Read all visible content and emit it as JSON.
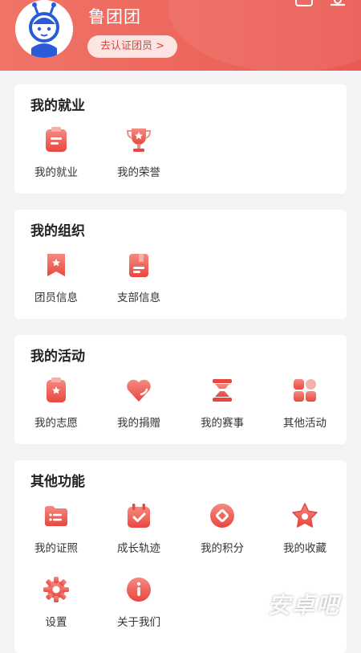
{
  "header": {
    "username": "鲁团团",
    "verify_button": "去认证团员 >",
    "avatar_icon": "mascot-avatar-icon",
    "top_icons": [
      "message-icon",
      "settings-icon"
    ],
    "gradient": [
      "#f07468",
      "#ea5a52"
    ]
  },
  "sections": {
    "employment": {
      "title": "我的就业",
      "items": [
        {
          "label": "我的就业",
          "icon": "clipboard-icon"
        },
        {
          "label": "我的荣誉",
          "icon": "trophy-icon"
        }
      ]
    },
    "organization": {
      "title": "我的组织",
      "items": [
        {
          "label": "团员信息",
          "icon": "bookmark-star-icon"
        },
        {
          "label": "支部信息",
          "icon": "notebook-icon"
        }
      ]
    },
    "activity": {
      "title": "我的活动",
      "items": [
        {
          "label": "我的志愿",
          "icon": "volunteer-icon"
        },
        {
          "label": "我的捐赠",
          "icon": "heart-icon"
        },
        {
          "label": "我的赛事",
          "icon": "hourglass-icon"
        },
        {
          "label": "其他活动",
          "icon": "apps-grid-icon"
        }
      ]
    },
    "other": {
      "title": "其他功能",
      "items": [
        {
          "label": "我的证照",
          "icon": "folder-list-icon"
        },
        {
          "label": "成长轨迹",
          "icon": "calendar-check-icon"
        },
        {
          "label": "我的积分",
          "icon": "points-coin-icon"
        },
        {
          "label": "我的收藏",
          "icon": "star-icon"
        },
        {
          "label": "设置",
          "icon": "gear-icon"
        },
        {
          "label": "关于我们",
          "icon": "info-icon"
        }
      ]
    }
  },
  "watermark": "安卓吧",
  "colors": {
    "accent": "#e8473f",
    "accent_light": "#f28c83",
    "background": "#f3f3f6"
  }
}
